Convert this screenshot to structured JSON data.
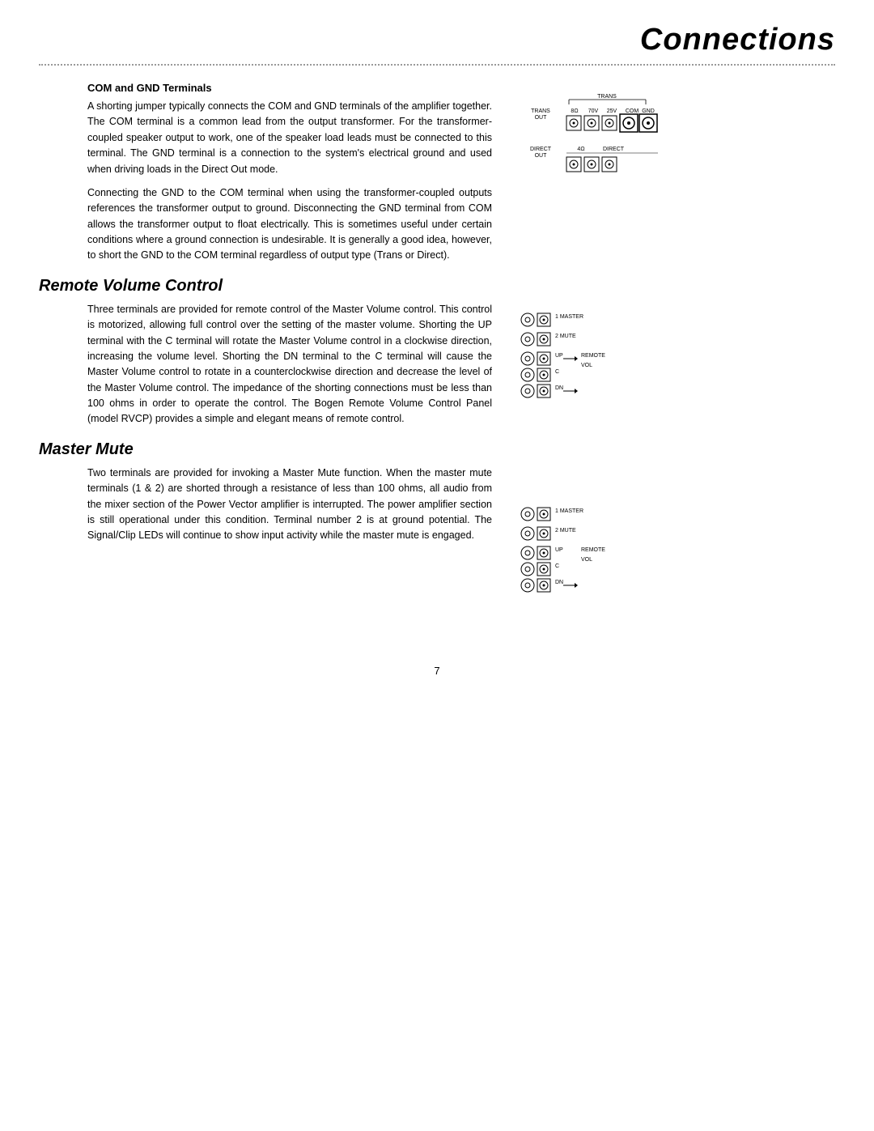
{
  "header": {
    "title": "Connections"
  },
  "sections": {
    "com_gnd": {
      "heading": "COM and GND Terminals",
      "paragraph1": "A shorting jumper typically connects the COM and GND terminals of the amplifier together. The COM terminal is a common lead from the output transformer. For the transformer-coupled speaker output to work, one of the speaker load leads must be connected to this terminal. The GND terminal is a connection to the system's electrical ground and used when driving loads in the Direct Out mode.",
      "paragraph2": "Connecting the GND to the COM terminal when using the transformer-coupled outputs references the transformer output to ground. Disconnecting the GND terminal from COM allows the transformer output to float electrically. This is sometimes useful under certain conditions where a ground connection is undesirable. It is generally a good idea, however, to short the GND to the COM terminal regardless of output type (Trans or Direct)."
    },
    "remote_volume": {
      "heading": "Remote Volume Control",
      "paragraph": "Three terminals are provided for remote control of the Master Volume control. This control is motorized, allowing full control over the setting of the master volume. Shorting the UP terminal with the C terminal will rotate the Master Volume control in a clockwise direction, increasing the volume level. Shorting the DN terminal to the C terminal will cause the Master Volume control to rotate in a counterclockwise direction and decrease the level of the Master Volume control. The impedance of the shorting connections must be less than 100 ohms in order to operate the control. The Bogen Remote Volume Control Panel (model RVCP) provides a simple and elegant means of remote control."
    },
    "master_mute": {
      "heading": "Master Mute",
      "paragraph": "Two terminals are provided for invoking a Master Mute function. When the master mute terminals (1 & 2) are shorted through a resistance of less than 100 ohms, all audio from the mixer section of the Power Vector amplifier is interrupted. The power amplifier section is still operational under this condition. Terminal number 2 is at ground potential. The Signal/Clip LEDs will continue to show input activity while the master mute is engaged."
    }
  },
  "diagrams": {
    "trans_labels": {
      "trans_top": "TRANS",
      "trans_out": "TRANS OUT",
      "eight_ohm": "8Ω",
      "seventy_v": "70V",
      "twenty_five_v": "25V",
      "com": "COM",
      "gnd": "GND",
      "direct_out": "DIRECT OUT",
      "four_ohm": "4Ω",
      "direct": "DIRECT"
    },
    "remote_vol_labels": {
      "master": "MASTER",
      "mute": "MUTE",
      "up": "UP",
      "remote": "REMOTE",
      "vol": "VOL",
      "c": "C",
      "dn": "DN",
      "num1": "1",
      "num2": "2"
    },
    "master_mute_labels": {
      "master": "MASTER",
      "mute": "MUTE",
      "up": "UP",
      "remote": "REMOTE",
      "vol": "VOL",
      "c": "C",
      "dn": "DN",
      "num1": "1",
      "num2": "2"
    }
  },
  "footer": {
    "page_number": "7"
  }
}
